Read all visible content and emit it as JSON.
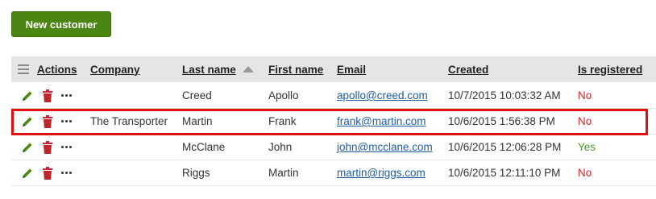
{
  "toolbar": {
    "new_customer_label": "New customer"
  },
  "grid": {
    "headers": {
      "actions": "Actions",
      "company": "Company",
      "last_name": "Last name",
      "first_name": "First name",
      "email": "Email",
      "created": "Created",
      "is_registered": "Is registered"
    },
    "sort": {
      "column": "last_name",
      "direction": "ascending"
    },
    "rows": [
      {
        "company": "",
        "last_name": "Creed",
        "first_name": "Apollo",
        "email": "apollo@creed.com",
        "created": "10/7/2015 10:03:32 AM",
        "is_registered": "No"
      },
      {
        "company": "The Transporter",
        "last_name": "Martin",
        "first_name": "Frank",
        "email": "frank@martin.com",
        "created": "10/6/2015 1:56:38 PM",
        "is_registered": "No"
      },
      {
        "company": "",
        "last_name": "McClane",
        "first_name": "John",
        "email": "john@mcclane.com",
        "created": "10/6/2015 12:06:28 PM",
        "is_registered": "Yes"
      },
      {
        "company": "",
        "last_name": "Riggs",
        "first_name": "Martin",
        "email": "martin@riggs.com",
        "created": "10/6/2015 12:11:10 PM",
        "is_registered": "No"
      }
    ],
    "highlighted_row": 1
  },
  "icons": {
    "edit": "pencil-icon",
    "delete": "trash-icon",
    "more": "more-actions-icon",
    "column_menu": "menu-icon",
    "sort": "sort-ascending-icon"
  },
  "colors": {
    "primary_button": "#4b8613",
    "edit_icon": "#4b8613",
    "delete_icon": "#c0272d",
    "no": "#d02a2a",
    "yes": "#4b9a2a",
    "link": "#1f5d9e",
    "highlight": "#e01010"
  }
}
